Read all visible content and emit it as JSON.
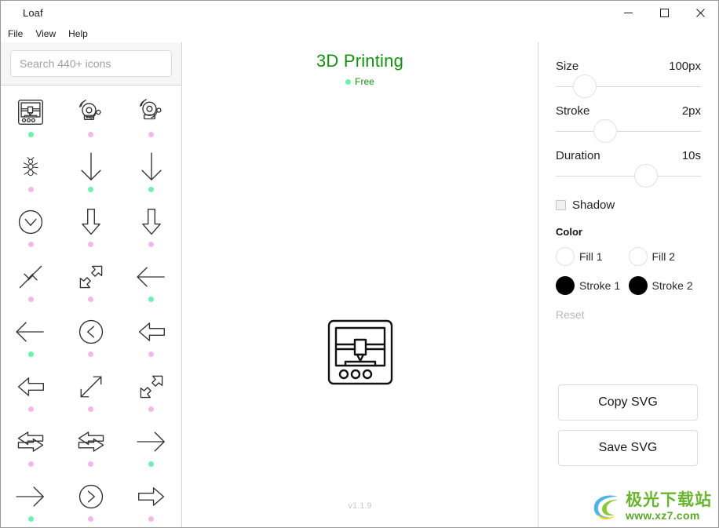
{
  "window": {
    "title": "Loaf",
    "controls": [
      {
        "name": "minimize",
        "glyph": "minimize-icon"
      },
      {
        "name": "maximize",
        "glyph": "maximize-icon"
      },
      {
        "name": "close",
        "glyph": "close-icon"
      }
    ]
  },
  "menu": {
    "items": [
      {
        "label": "File"
      },
      {
        "label": "View"
      },
      {
        "label": "Help"
      }
    ]
  },
  "search": {
    "placeholder": "Search 440+ icons",
    "value": ""
  },
  "icon_grid": {
    "icons": [
      {
        "name": "3d-printer-icon",
        "tier": "free",
        "selected": true
      },
      {
        "name": "alarm-bell-icon",
        "tier": "pro",
        "selected": false
      },
      {
        "name": "alarm-bell-alt-icon",
        "tier": "pro",
        "selected": false
      },
      {
        "name": "ant-icon",
        "tier": "pro",
        "selected": false
      },
      {
        "name": "arrow-down-thin-icon",
        "tier": "free",
        "selected": false
      },
      {
        "name": "arrow-down-thin-alt-icon",
        "tier": "free",
        "selected": false
      },
      {
        "name": "chevron-down-circle-icon",
        "tier": "pro",
        "selected": false
      },
      {
        "name": "arrow-down-block-icon",
        "tier": "pro",
        "selected": false
      },
      {
        "name": "arrow-down-block-alt-icon",
        "tier": "pro",
        "selected": false
      },
      {
        "name": "arrows-collapse-diagonal-icon",
        "tier": "pro",
        "selected": false
      },
      {
        "name": "arrows-expand-block-diagonal-icon",
        "tier": "pro",
        "selected": false
      },
      {
        "name": "arrow-left-thin-icon",
        "tier": "free",
        "selected": false
      },
      {
        "name": "arrow-left-thin-alt-icon",
        "tier": "free",
        "selected": false
      },
      {
        "name": "chevron-left-circle-icon",
        "tier": "pro",
        "selected": false
      },
      {
        "name": "arrow-left-block-icon",
        "tier": "pro",
        "selected": false
      },
      {
        "name": "arrow-left-block-alt-icon",
        "tier": "pro",
        "selected": false
      },
      {
        "name": "arrows-expand-diagonal-icon",
        "tier": "pro",
        "selected": false
      },
      {
        "name": "arrows-expand-block-diagonal-alt-icon",
        "tier": "pro",
        "selected": false
      },
      {
        "name": "arrows-left-right-block-icon",
        "tier": "pro",
        "selected": false
      },
      {
        "name": "arrows-left-right-block-alt-icon",
        "tier": "pro",
        "selected": false
      },
      {
        "name": "arrow-right-thin-icon",
        "tier": "free",
        "selected": false
      },
      {
        "name": "arrow-right-thin-alt-icon",
        "tier": "free",
        "selected": false
      },
      {
        "name": "chevron-right-circle-icon",
        "tier": "pro",
        "selected": false
      },
      {
        "name": "arrow-right-block-icon",
        "tier": "pro",
        "selected": false
      }
    ]
  },
  "preview": {
    "title": "3D Printing",
    "badge": "Free",
    "icon": "3d-printer-icon",
    "version": "v1.1.9"
  },
  "settings": {
    "size": {
      "label": "Size",
      "value": "100px",
      "percent": 20
    },
    "stroke": {
      "label": "Stroke",
      "value": "2px",
      "percent": 34
    },
    "duration": {
      "label": "Duration",
      "value": "10s",
      "percent": 62
    },
    "shadow": {
      "label": "Shadow",
      "checked": false
    },
    "color_heading": "Color",
    "swatches": [
      {
        "label": "Fill 1",
        "color": "#ffffff",
        "filled": false
      },
      {
        "label": "Fill 2",
        "color": "#ffffff",
        "filled": false
      },
      {
        "label": "Stroke 1",
        "color": "#000000",
        "filled": true
      },
      {
        "label": "Stroke 2",
        "color": "#000000",
        "filled": true
      }
    ],
    "reset_label": "Reset",
    "copy_label": "Copy SVG",
    "save_label": "Save SVG"
  },
  "watermark": {
    "name": "极光下载站",
    "url": "www.xz7.com"
  },
  "colors": {
    "accent_green": "#13930f",
    "free_dot": "#6ff0b0",
    "pro_dot": "#f3b8e8",
    "border": "#d2d6da"
  }
}
